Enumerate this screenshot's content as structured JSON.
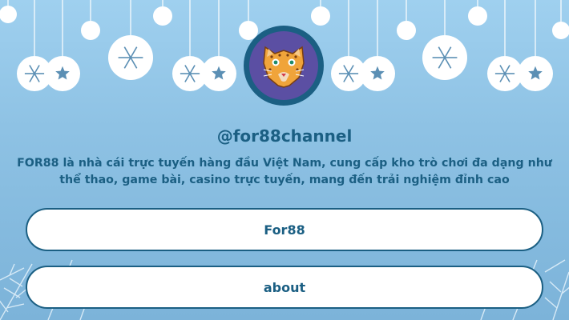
{
  "profile": {
    "handle": "@for88channel",
    "description": "FOR88 là nhà cái trực tuyến hàng đầu Việt Nam, cung cấp kho trò chơi đa dạng như thể thao, game bài, casino trực tuyến, mang đến trải nghiệm đỉnh cao",
    "avatar_icon": "leopard-face-icon"
  },
  "links": [
    {
      "label": "For88"
    },
    {
      "label": "about"
    }
  ],
  "colors": {
    "accent": "#1b5f83",
    "background_top": "#9fd0ef",
    "background_bottom": "#7cb3d9",
    "button_bg": "#ffffff"
  },
  "decor": {
    "ornament_snowflake_icon": "snowflake-ornament-icon",
    "ornament_star_icon": "star-ornament-icon",
    "foliage_icon": "frosted-pine-branch-icon"
  }
}
